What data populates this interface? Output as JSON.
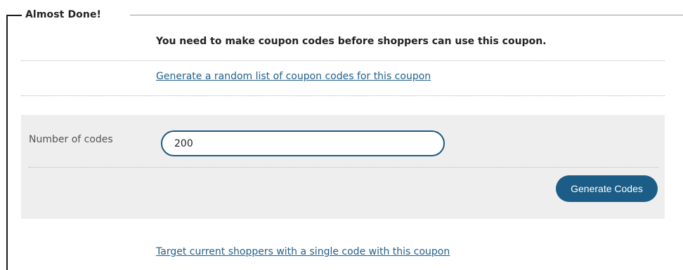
{
  "section": {
    "legend": "Almost Done!",
    "notice": "You need to make coupon codes before shoppers can use this coupon."
  },
  "links": {
    "random_list": "Generate a random list of coupon codes for this coupon",
    "single_code": "Target current shoppers with a single code with this coupon"
  },
  "form": {
    "label": "Number of codes",
    "value": "200",
    "button_label": "Generate Codes"
  },
  "colors": {
    "accent": "#1b5d86",
    "link": "#1f5f8a",
    "panel": "#eeeeee"
  }
}
